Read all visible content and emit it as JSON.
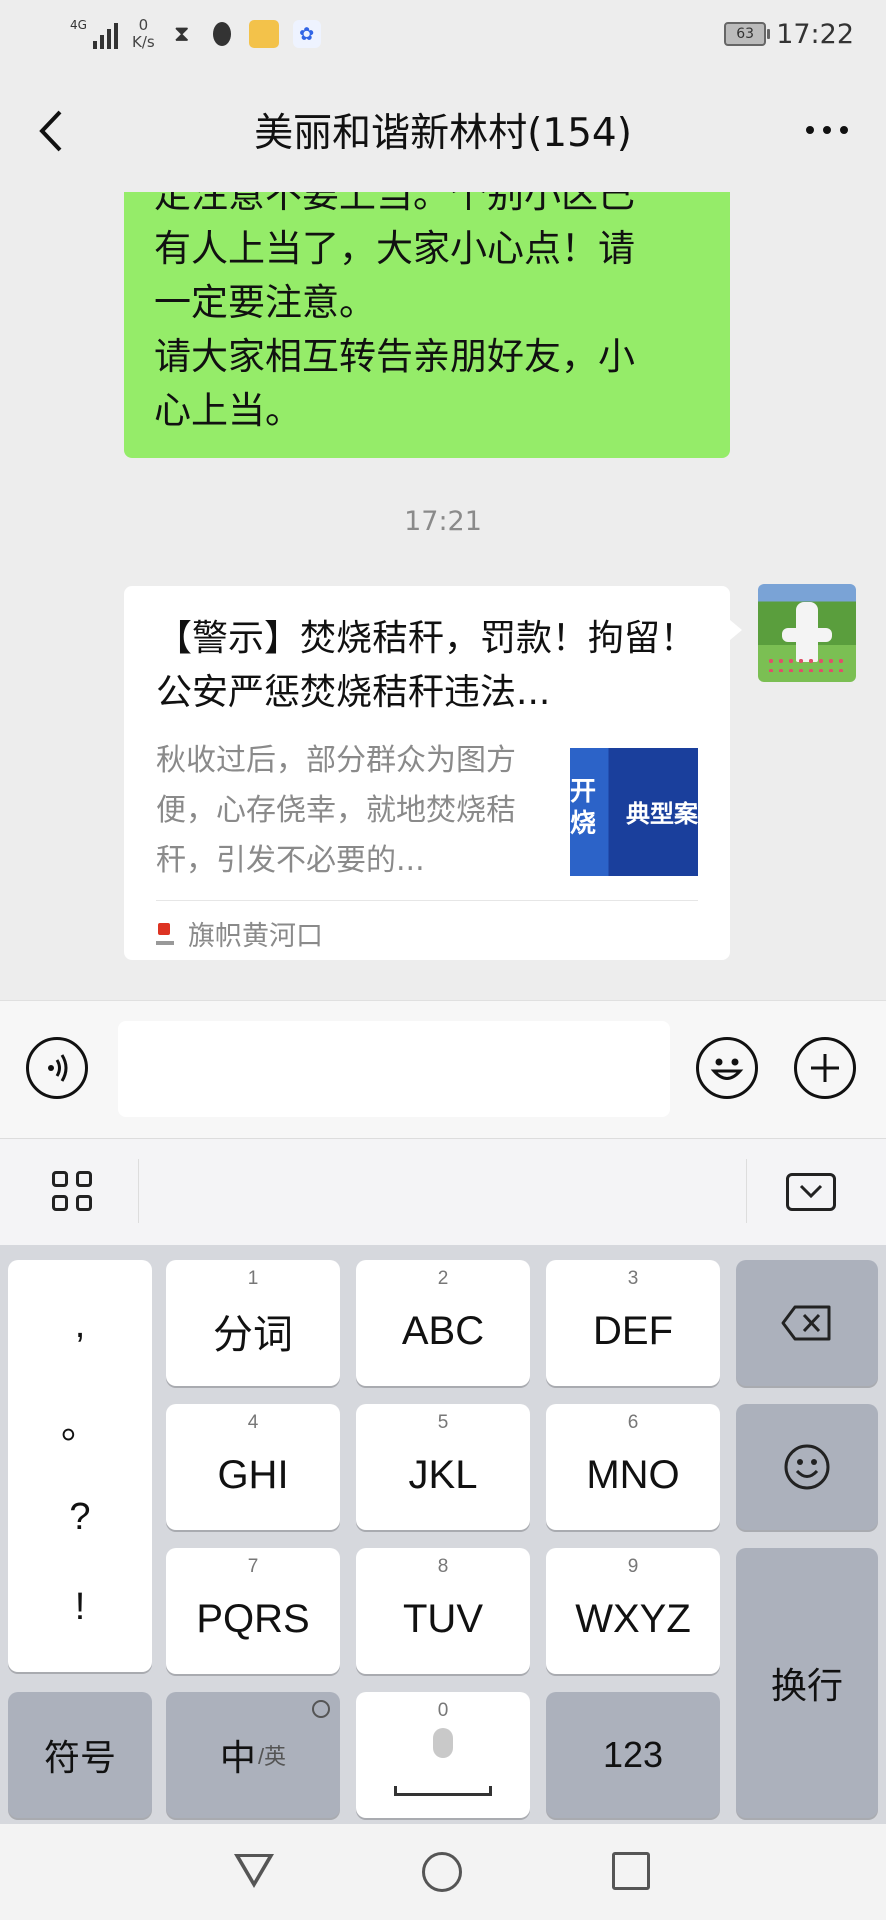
{
  "status_bar": {
    "network": "4G",
    "net_speed_value": "0",
    "net_speed_unit": "K/s",
    "battery": "63",
    "time": "17:22"
  },
  "header": {
    "title": "美丽和谐新林村(154)"
  },
  "chat": {
    "partial_message_lines": [
      "定注意不要上当。个别小区已",
      "有人上当了，大家小心点！请",
      "一定要注意。",
      "请大家相互转告亲朋好友，小",
      "心上当。"
    ],
    "timestamp": "17:21",
    "card": {
      "title": "【警示】焚烧秸秆，罚款！拘留！公安严惩焚烧秸秆违法...",
      "description": "秋收过后，部分群众为图方便，心存侥幸，就地焚烧秸秆，引发不必要的...",
      "thumbnail_text": "典型案",
      "thumbnail_left_text": "开\n烧",
      "source": "旗帜黄河口"
    }
  },
  "keyboard": {
    "punctuation": [
      ",",
      "。",
      "?",
      "!"
    ],
    "keys": [
      {
        "num": "1",
        "label": "分词"
      },
      {
        "num": "2",
        "label": "ABC"
      },
      {
        "num": "3",
        "label": "DEF"
      },
      {
        "num": "4",
        "label": "GHI"
      },
      {
        "num": "5",
        "label": "JKL"
      },
      {
        "num": "6",
        "label": "MNO"
      },
      {
        "num": "7",
        "label": "PQRS"
      },
      {
        "num": "8",
        "label": "TUV"
      },
      {
        "num": "9",
        "label": "WXYZ"
      }
    ],
    "symbols_label": "符号",
    "lang_main": "中",
    "lang_sub": "/英",
    "space_num": "0",
    "numbers_label": "123",
    "enter_label": "换行"
  },
  "icons": {
    "back": "back-chevron-icon",
    "more": "more-dots-icon",
    "voice": "voice-icon",
    "emoji": "emoji-icon",
    "plus": "plus-icon",
    "grid": "grid-icon",
    "collapse": "keyboard-collapse-icon",
    "backspace": "backspace-icon",
    "smiley": "smiley-icon"
  },
  "colors": {
    "bubble_green": "#95ec69",
    "background": "#ededed"
  }
}
